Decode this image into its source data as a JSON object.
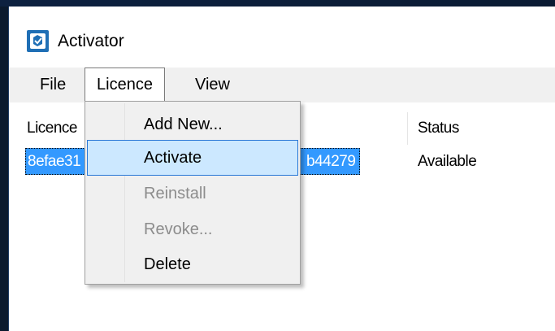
{
  "window": {
    "title": "Activator",
    "icon": "activator-app-icon"
  },
  "menubar": {
    "items": [
      {
        "label": "File"
      },
      {
        "label": "Licence"
      },
      {
        "label": "View"
      }
    ],
    "open_menu": "Licence"
  },
  "licence_menu": {
    "items": [
      {
        "label": "Add New...",
        "enabled": true
      },
      {
        "label": "Activate",
        "enabled": true,
        "highlighted": true
      },
      {
        "label": "Reinstall",
        "enabled": false
      },
      {
        "label": "Revoke...",
        "enabled": false
      },
      {
        "label": "Delete",
        "enabled": true
      }
    ]
  },
  "list": {
    "columns": [
      {
        "label": "Licence"
      },
      {
        "label": "Status"
      }
    ],
    "rows": [
      {
        "licence_start": "8efae31",
        "licence_end": "b44279",
        "status": "Available",
        "selected": true
      }
    ]
  },
  "colors": {
    "selection": "#3399ff",
    "menu_highlight": "#cce8ff",
    "menu_highlight_border": "#2a78d6",
    "menubar_bg": "#f0f0f0"
  }
}
